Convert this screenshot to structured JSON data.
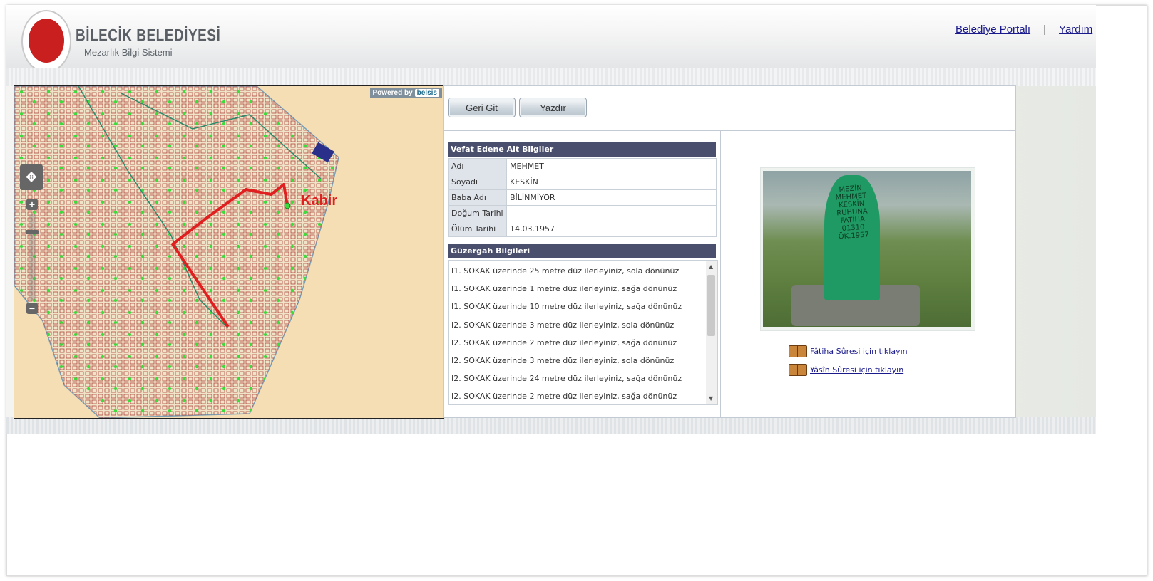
{
  "header": {
    "brand_title": "BİLECİK BELEDİYESİ",
    "brand_subtitle": "Mezarlık Bilgi Sistemi",
    "links": {
      "portal": "Belediye Portalı",
      "separator": "|",
      "help": "Yardım"
    }
  },
  "map": {
    "powered_by": "Powered by",
    "powered_brand": "belsis",
    "destination_label": "Kabir",
    "controls": {
      "zoom_in": "+",
      "zoom_out": "−",
      "pan": "✥"
    }
  },
  "toolbar": {
    "back_label": "Geri Git",
    "print_label": "Yazdır"
  },
  "deceased": {
    "section_title": "Vefat Edene Ait Bilgiler",
    "fields": [
      {
        "label": "Adı",
        "value": "MEHMET"
      },
      {
        "label": "Soyadı",
        "value": "KESKİN"
      },
      {
        "label": "Baba Adı",
        "value": "BİLİNMİYOR"
      },
      {
        "label": "Doğum Tarihi",
        "value": ""
      },
      {
        "label": "Ölüm Tarihi",
        "value": "14.03.1957"
      }
    ]
  },
  "route": {
    "section_title": "Güzergah Bilgileri",
    "steps": [
      "I1. SOKAK üzerinde 25 metre düz ilerleyiniz, sola dönünüz",
      "I1. SOKAK üzerinde 1 metre düz ilerleyiniz, sağa dönünüz",
      "I1. SOKAK üzerinde 10 metre düz ilerleyiniz, sağa dönünüz",
      "I2. SOKAK üzerinde 3 metre düz ilerleyiniz, sola dönünüz",
      "I2. SOKAK üzerinde 2 metre düz ilerleyiniz, sağa dönünüz",
      "I2. SOKAK üzerinde 3 metre düz ilerleyiniz, sola dönünüz",
      "I2. SOKAK üzerinde 24 metre düz ilerleyiniz, sağa dönünüz",
      "I2. SOKAK üzerinde 2 metre düz ilerleyiniz, sağa dönünüz"
    ]
  },
  "gravestone": {
    "inscription": [
      "MEZİN",
      "MEHMET",
      "KESKİN",
      "RUHUNA",
      "FATİHA",
      "01310",
      "ÖK.1957"
    ]
  },
  "prayers": {
    "fatiha": "Fâtiha Sûresi için tıklayın",
    "yasin": "Yâsîn Sûresi için tıklayın"
  },
  "colors": {
    "section_header": "#4a4f6e",
    "route_line": "#e02020",
    "map_background": "#f5deb3",
    "link": "#1a1a8c"
  }
}
